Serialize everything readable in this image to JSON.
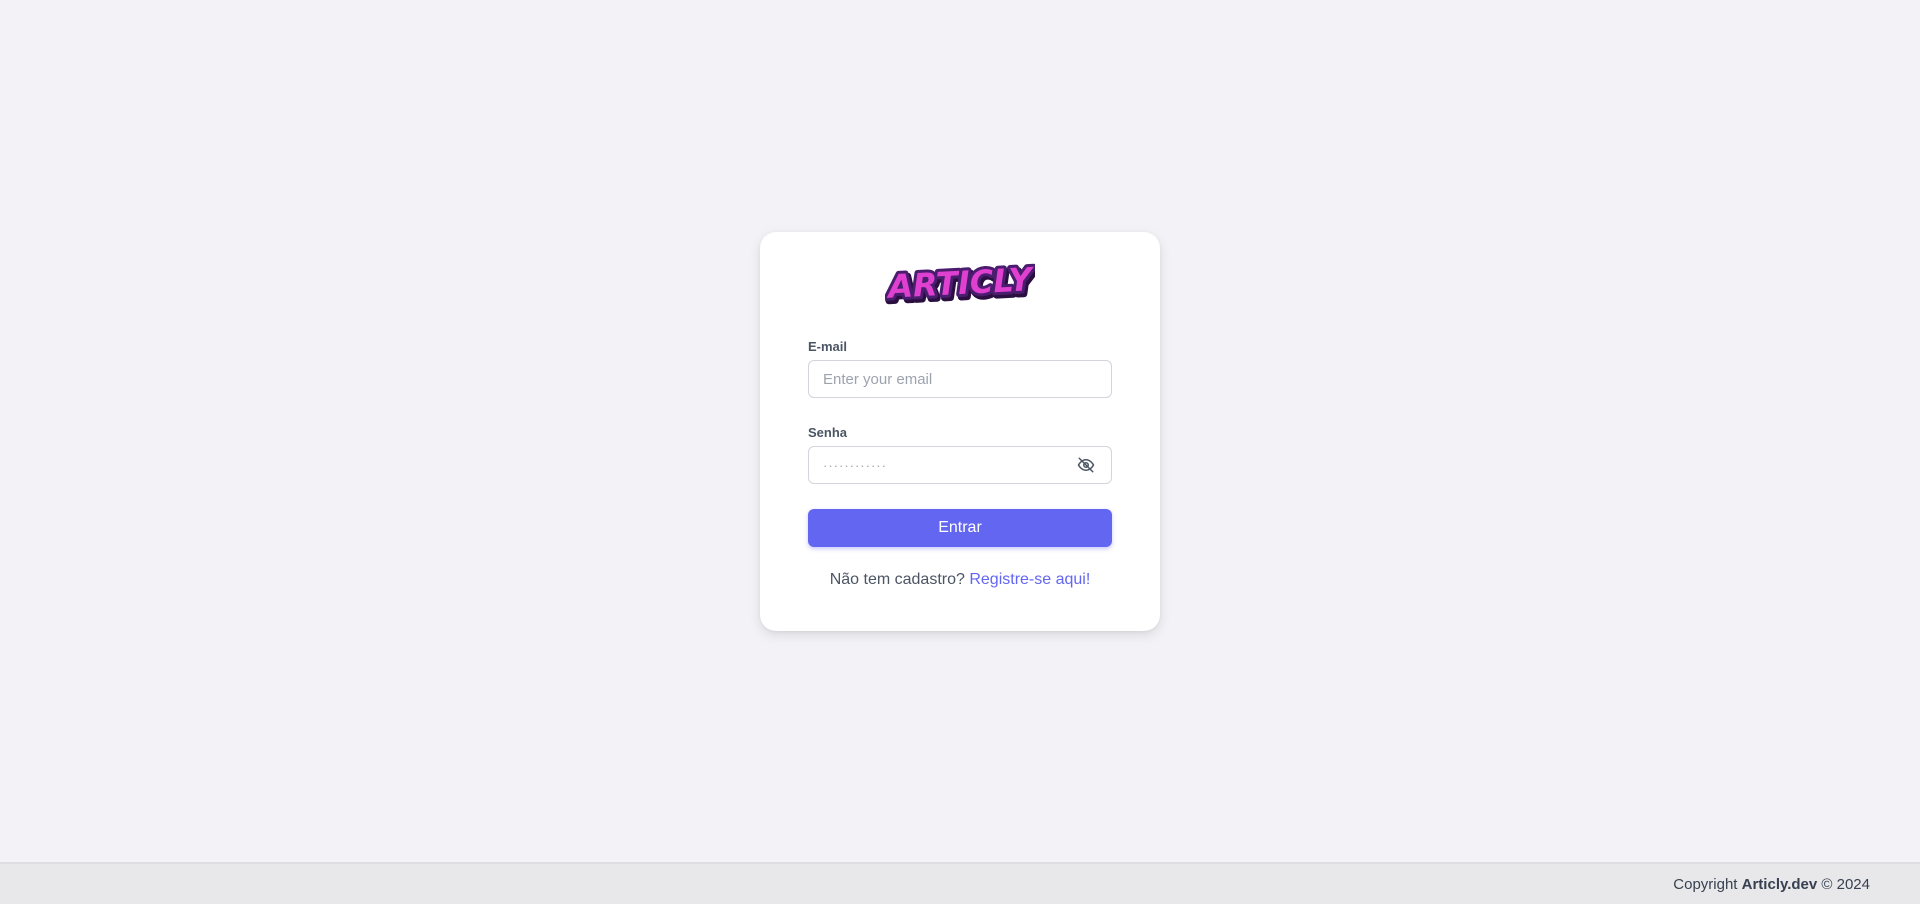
{
  "brand": {
    "logo_text": "ARTICLY",
    "logo_fill": "#e040d0",
    "logo_outline": "#4a1d6e"
  },
  "login": {
    "email_label": "E-mail",
    "email_placeholder": "Enter your email",
    "password_label": "Senha",
    "password_placeholder": "············",
    "password_toggle_icon": "eye-off-icon",
    "submit_label": "Entrar",
    "register_prompt": "Não tem cadastro?",
    "register_link": "Registre-se aqui!"
  },
  "footer": {
    "prefix": "Copyright",
    "site": "Articly.dev",
    "suffix": "© 2024"
  },
  "colors": {
    "accent": "#6366f1",
    "background": "#f3f3f7",
    "card": "#ffffff",
    "footer": "#e8e8ea"
  }
}
